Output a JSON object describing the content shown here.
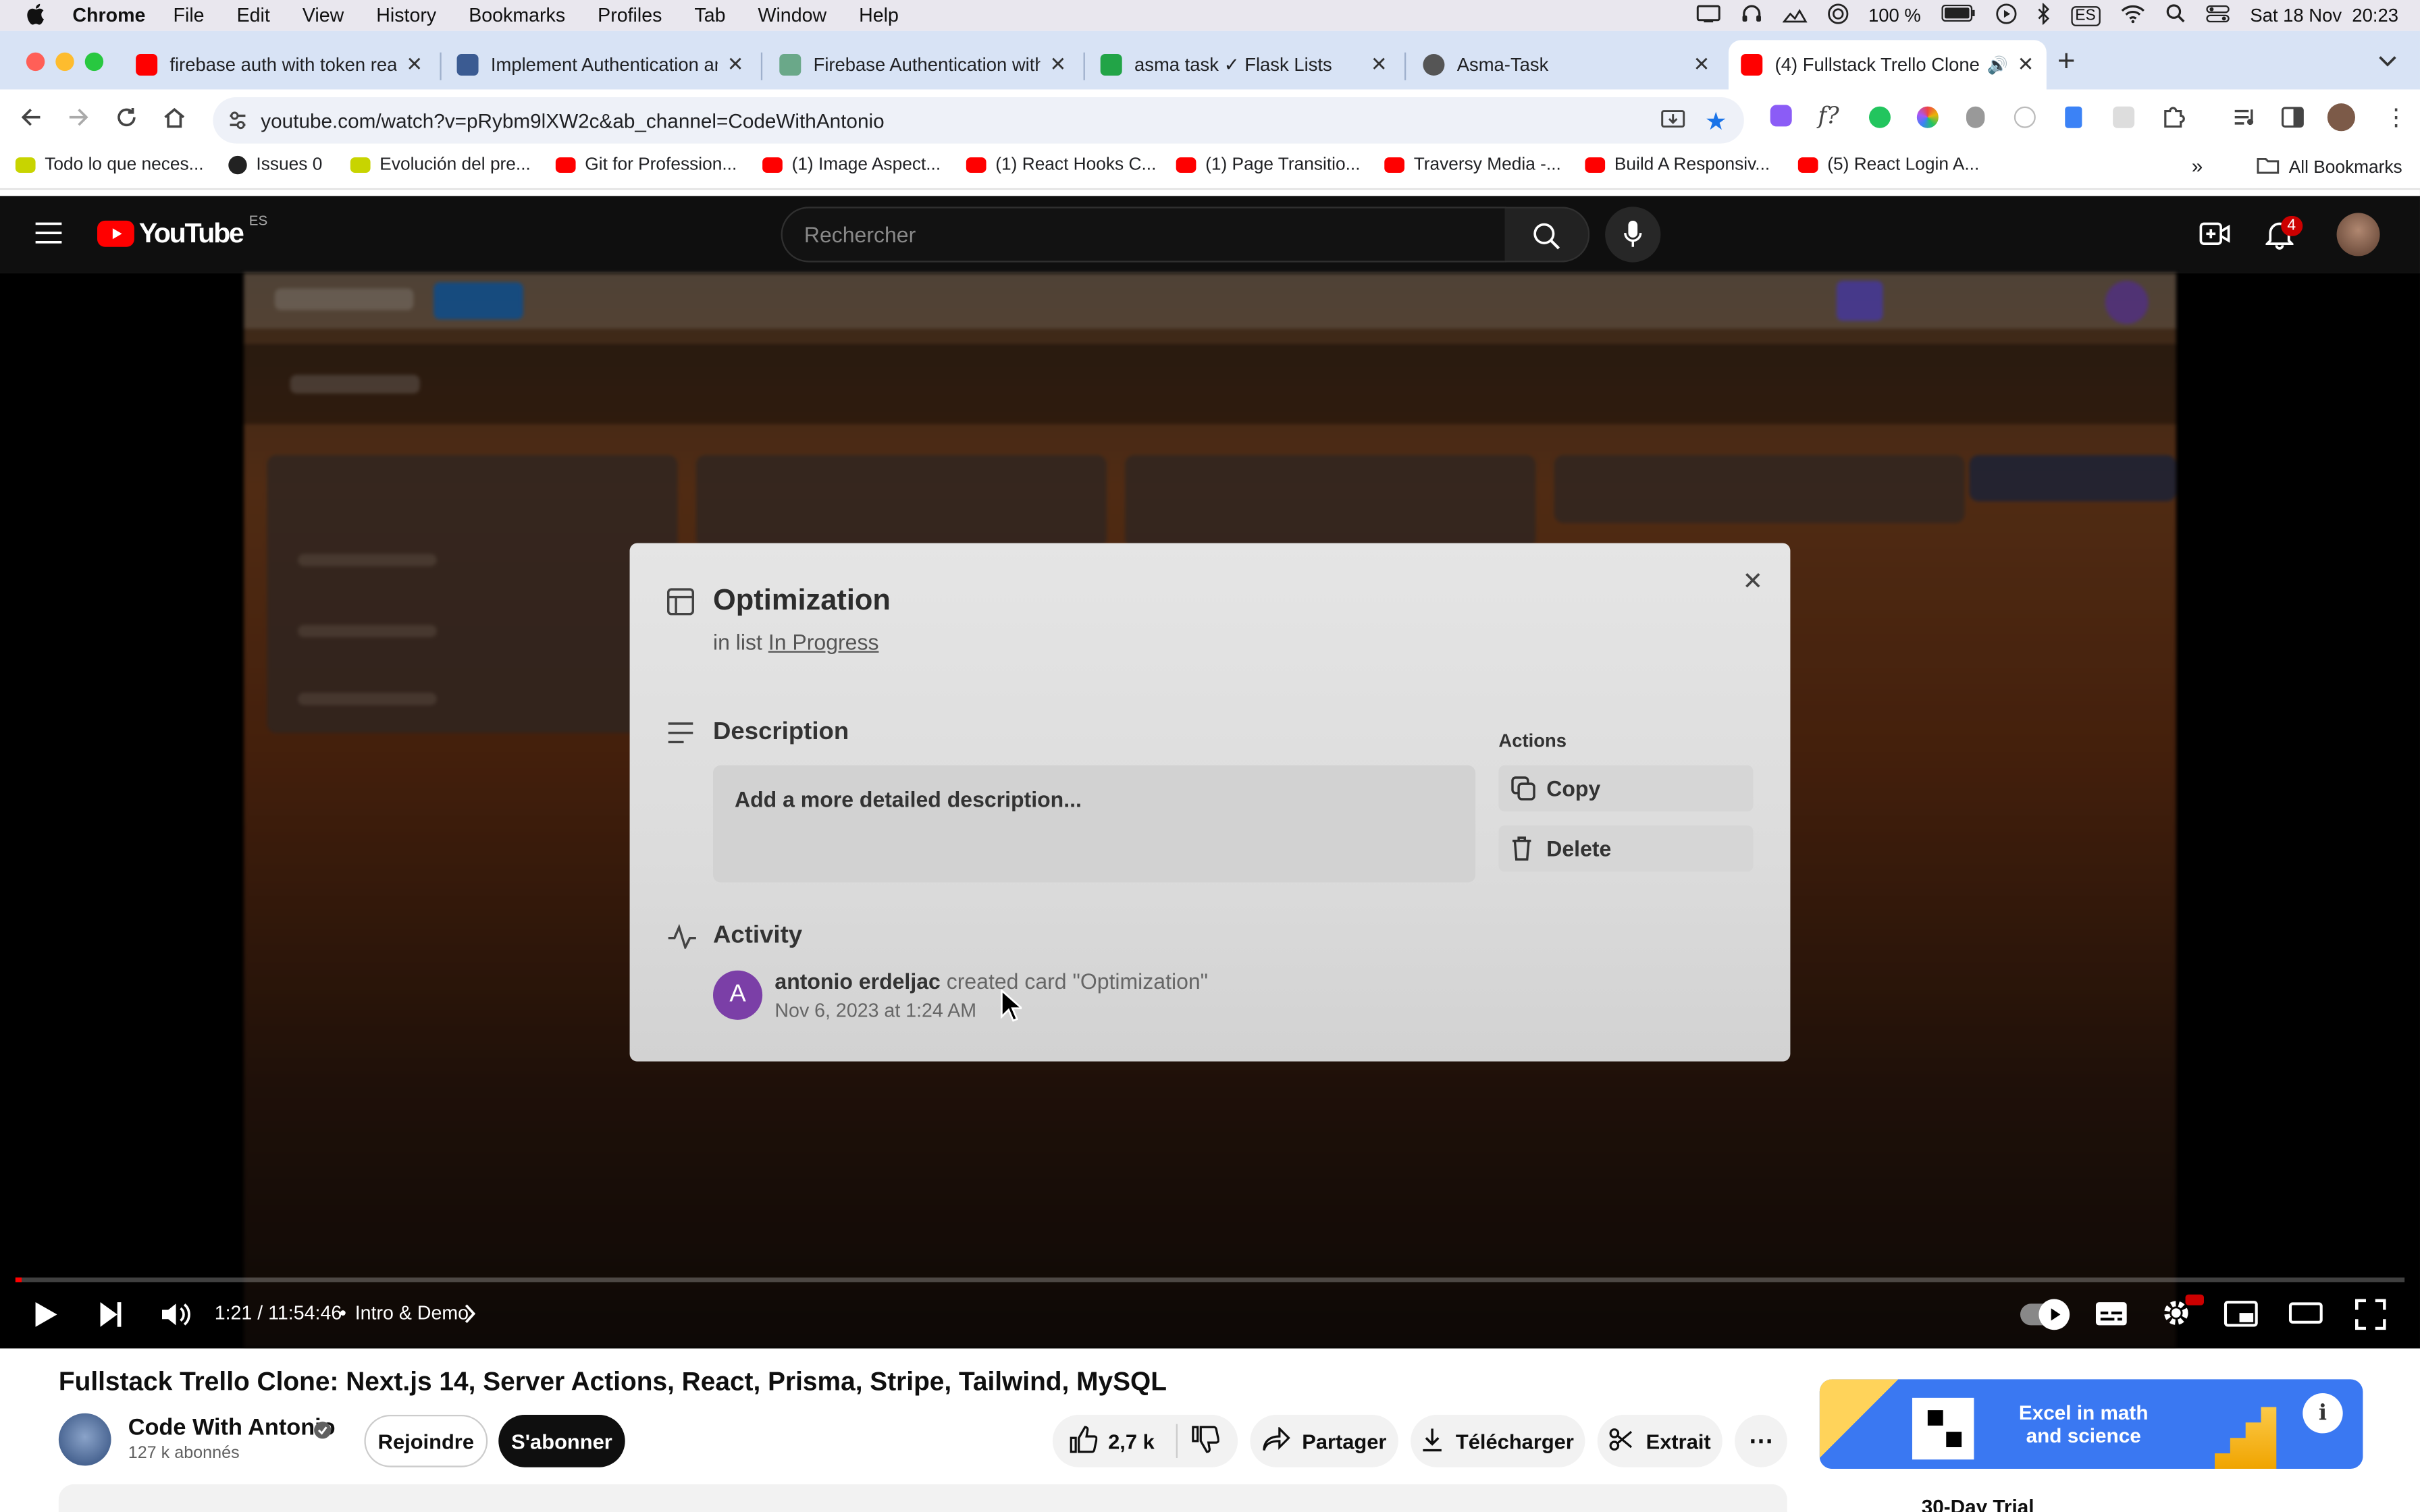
{
  "macos_menubar": {
    "app": "Chrome",
    "items": [
      "File",
      "Edit",
      "View",
      "History",
      "Bookmarks",
      "Profiles",
      "Tab",
      "Window",
      "Help"
    ],
    "battery": "100 %",
    "input_source": "ES",
    "datetime": "Sat 18 Nov  20:23"
  },
  "tabs": [
    {
      "title": "firebase auth with token reac",
      "favicon_color": "#ff0000"
    },
    {
      "title": "Implement Authentication an",
      "favicon_color": "#3b5b92"
    },
    {
      "title": "Firebase Authentication with",
      "favicon_color": "#6aa889"
    },
    {
      "title": "asma task ✓ Flask Lists",
      "favicon_color": "#22a447"
    },
    {
      "title": "Asma-Task",
      "favicon_color": "#555555"
    },
    {
      "title": "(4) Fullstack Trello Clone",
      "favicon_color": "#ff0000"
    }
  ],
  "address_bar": {
    "url": "youtube.com/watch?v=pRybm9lXW2c&ab_channel=CodeWithAntonio"
  },
  "bookmarks": [
    {
      "label": "Todo lo que neces...",
      "color": "#c8d400"
    },
    {
      "label": "Issues 0",
      "color": "#222222"
    },
    {
      "label": "Evolución del pre...",
      "color": "#c8d400"
    },
    {
      "label": "Git for Profession...",
      "color": "#ff0000"
    },
    {
      "label": "(1) Image Aspect...",
      "color": "#ff0000"
    },
    {
      "label": "(1) React Hooks C...",
      "color": "#ff0000"
    },
    {
      "label": "(1) Page Transitio...",
      "color": "#ff0000"
    },
    {
      "label": "Traversy Media -...",
      "color": "#ff0000"
    },
    {
      "label": "Build A Responsiv...",
      "color": "#ff0000"
    },
    {
      "label": "(5) React Login A...",
      "color": "#ff0000"
    }
  ],
  "all_bookmarks": "All Bookmarks",
  "youtube": {
    "logo": "YouTube",
    "region": "ES",
    "search_placeholder": "Rechercher",
    "notifications": "4"
  },
  "card_modal": {
    "title": "Optimization",
    "in_list_prefix": "in list",
    "list_name": "In Progress",
    "description_heading": "Description",
    "description_placeholder": "Add a more detailed description...",
    "actions_heading": "Actions",
    "copy_label": "Copy",
    "delete_label": "Delete",
    "activity_heading": "Activity",
    "activity_avatar": "A",
    "activity_user": "antonio erdeljac",
    "activity_action": "created card \"Optimization\"",
    "activity_date": "Nov 6, 2023 at 1:24 AM",
    "close": "✕"
  },
  "player": {
    "time": "1:21 / 11:54:46",
    "chapter_sep": "•",
    "chapter": "Intro & Demo",
    "progress_fraction": 0.0019
  },
  "video_info": {
    "title": "Fullstack Trello Clone: Next.js 14, Server Actions, React, Prisma, Stripe, Tailwind, MySQL",
    "channel": "Code With Antonio",
    "subscribers": "127 k abonnés",
    "join": "Rejoindre",
    "subscribe": "S'abonner",
    "likes": "2,7 k",
    "share": "Partager",
    "download": "Télécharger",
    "clip": "Extrait",
    "ad_text": "Excel in math and science",
    "ad_subtext": "30-Day Trial"
  }
}
